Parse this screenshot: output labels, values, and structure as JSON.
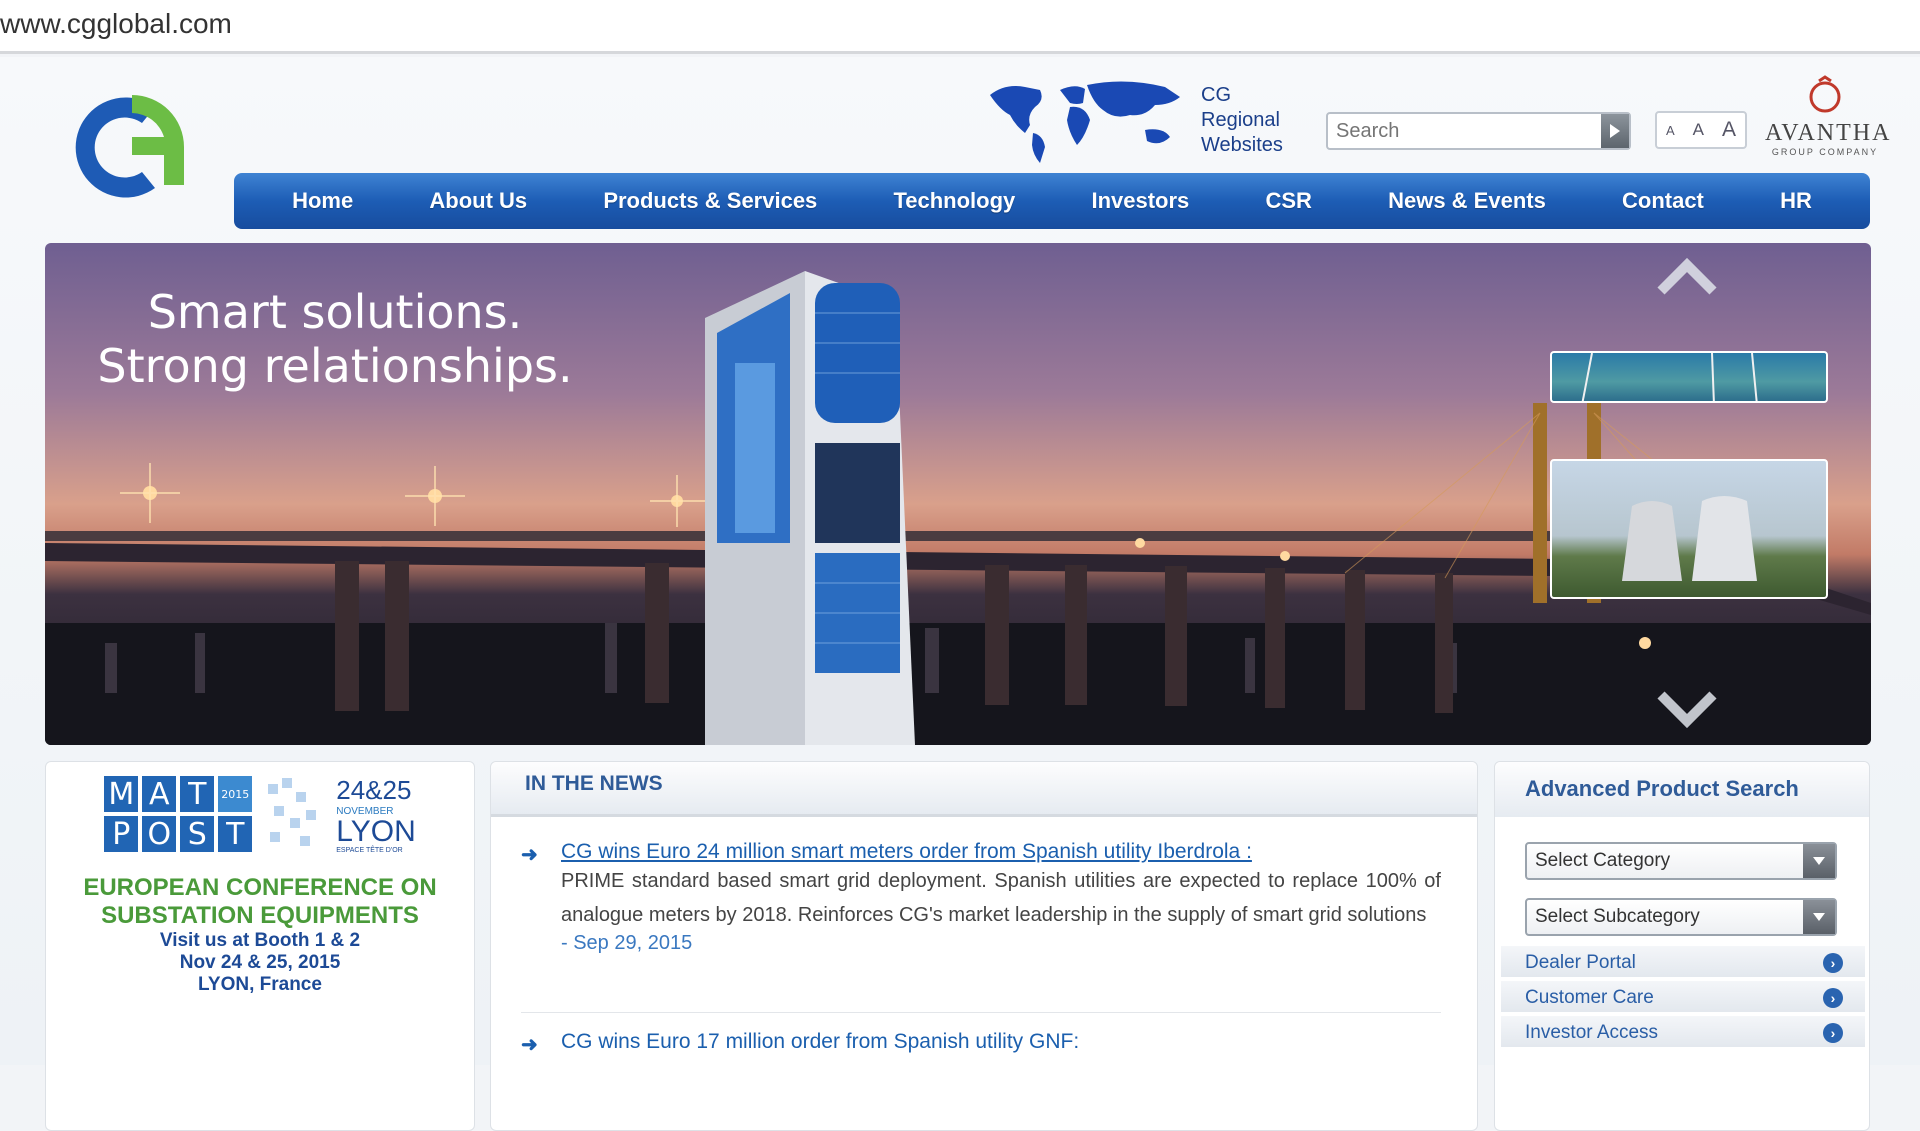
{
  "browser": {
    "url": "www.cgglobal.com"
  },
  "header": {
    "regional_lines": [
      "CG",
      "Regional",
      "Websites"
    ],
    "search_placeholder": "Search",
    "font_sizes": [
      "A",
      "A",
      "A"
    ],
    "avantha_name": "AVANTHA",
    "avantha_sub": "GROUP COMPANY"
  },
  "nav": {
    "items": [
      "Home",
      "About Us",
      "Products & Services",
      "Technology",
      "Investors",
      "CSR",
      "News & Events",
      "Contact",
      "HR"
    ]
  },
  "hero": {
    "tagline_1": "Smart solutions.",
    "tagline_2": "Strong relationships."
  },
  "event": {
    "mat_row1": [
      "M",
      "A",
      "T"
    ],
    "mat_row2": [
      "P",
      "O",
      "S",
      "T"
    ],
    "year": "2015",
    "dates": "24&25",
    "month": "NOVEMBER",
    "city": "LYON",
    "venue": "ESPACE TÊTE D'OR",
    "title_1": "EUROPEAN CONFERENCE ON",
    "title_2": "SUBSTATION EQUIPMENTS",
    "line_1": "Visit us at Booth 1 & 2",
    "line_2": "Nov 24 & 25, 2015",
    "line_3": "LYON, France"
  },
  "news": {
    "heading": "IN THE NEWS",
    "items": [
      {
        "title": "CG wins Euro 24 million smart meters order from Spanish utility Iberdrola :",
        "body": "PRIME standard based smart grid deployment. Spanish utilities are expected to replace 100% of analogue meters by 2018. Reinforces CG's market leadership in the supply of smart grid solutions",
        "date": "- Sep 29, 2015"
      },
      {
        "title": "CG wins Euro 17 million order from Spanish utility GNF:"
      }
    ]
  },
  "advanced_search": {
    "heading": "Advanced Product Search",
    "category_select": "Select Category",
    "subcategory_select": "Select Subcategory",
    "links": [
      "Dealer Portal",
      "Customer Care",
      "Investor Access"
    ]
  },
  "colors": {
    "nav_blue": "#1d5db5",
    "logo_blue": "#1e5bb5",
    "logo_green": "#6cbd45",
    "event_green": "#4a9a3a"
  }
}
